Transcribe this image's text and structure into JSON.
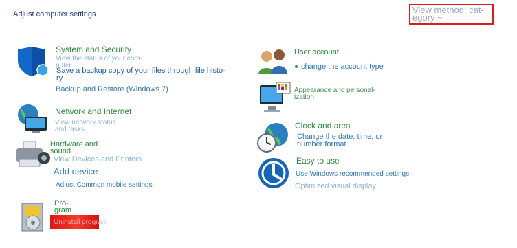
{
  "header": {
    "title": "Adjust computer settings",
    "view_method_line1": "View method: cat-",
    "view_method_line2": "egory ~"
  },
  "left": {
    "system_security": {
      "title": "System and Security",
      "link1_line1": "View the status of your com-",
      "link1_line2": "puter",
      "link2_line1": "Save a backup copy of your files through file histo-",
      "link2_line2": "ry",
      "link3": "Backup and Restore (Windows 7)"
    },
    "network": {
      "title": "Network and Internet",
      "link1_line1": "View network status",
      "link1_line2": "and tasks"
    },
    "hardware": {
      "title_line1": "Hardware and",
      "title_line2": "sound",
      "link1": "View Devices and Printers",
      "link2": "Add device",
      "link3": "Adjust Common mobile settings"
    },
    "program": {
      "title_line1": "Pro-",
      "title_line2": "gram",
      "link1": "Uninstall program"
    }
  },
  "right": {
    "user_account": {
      "title": "User account",
      "link1": "change the account type"
    },
    "appearance": {
      "title_line1": "Appearance and personal-",
      "title_line2": "ization"
    },
    "clock": {
      "title": "Clock and area",
      "link1_line1": "Change the date, time, or",
      "link1_line2": "number format"
    },
    "ease": {
      "title": "Easy to use",
      "link1": "Use Windows recommended settings",
      "link2": "Optimized visual display"
    }
  }
}
